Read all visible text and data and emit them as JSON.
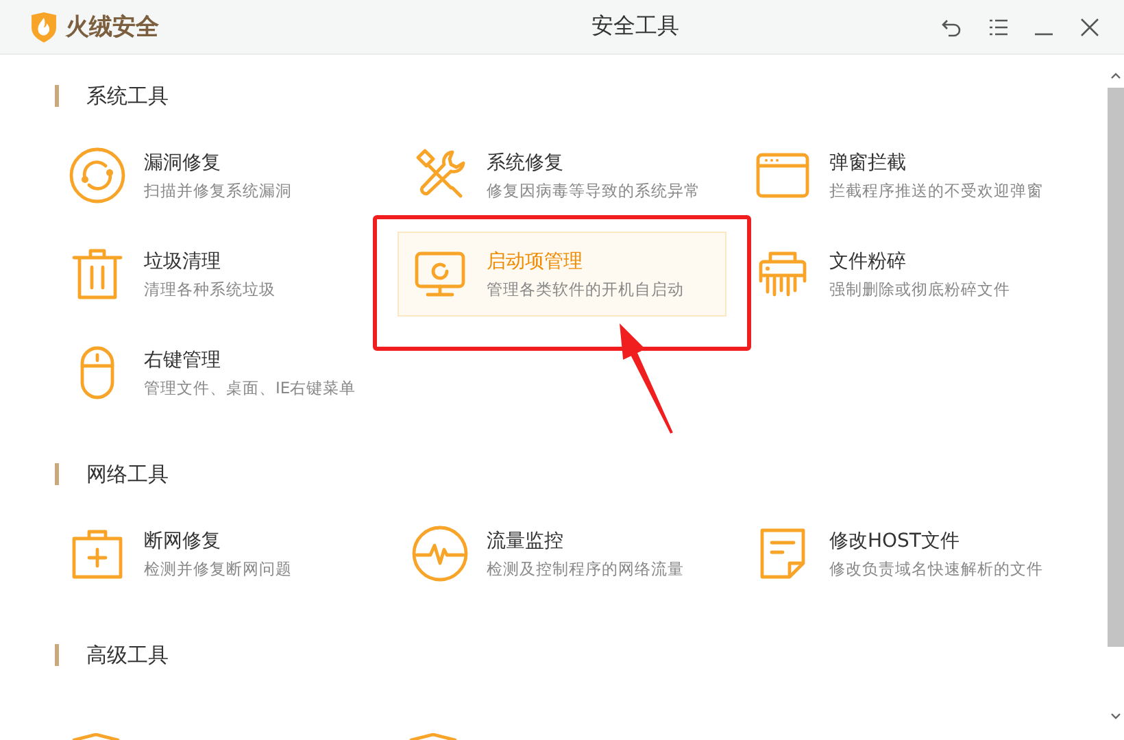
{
  "window": {
    "logo_text": "火绒安全",
    "title": "安全工具"
  },
  "sections": [
    {
      "title": "系统工具",
      "items": [
        {
          "title": "漏洞修复",
          "description": "扫描并修复系统漏洞",
          "selected": false
        },
        {
          "title": "系统修复",
          "description": "修复因病毒等导致的系统异常",
          "selected": false
        },
        {
          "title": "弹窗拦截",
          "description": "拦截程序推送的不受欢迎弹窗",
          "selected": false
        },
        {
          "title": "垃圾清理",
          "description": "清理各种系统垃圾",
          "selected": false
        },
        {
          "title": "启动项管理",
          "description": "管理各类软件的开机自启动",
          "selected": true
        },
        {
          "title": "文件粉碎",
          "description": "强制删除或彻底粉碎文件",
          "selected": false
        },
        {
          "title": "右键管理",
          "description": "管理文件、桌面、IE右键菜单",
          "selected": false
        }
      ]
    },
    {
      "title": "网络工具",
      "items": [
        {
          "title": "断网修复",
          "description": "检测并修复断网问题",
          "selected": false
        },
        {
          "title": "流量监控",
          "description": "检测及控制程序的网络流量",
          "selected": false
        },
        {
          "title": "修改HOST文件",
          "description": "修改负责域名快速解析的文件",
          "selected": false
        }
      ]
    },
    {
      "title": "高级工具"
    }
  ]
}
